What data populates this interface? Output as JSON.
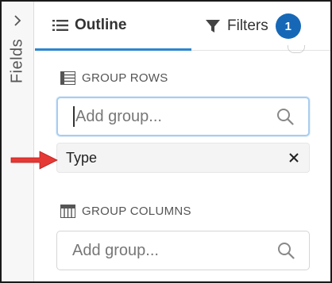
{
  "sidebar": {
    "label": "Fields",
    "toggle_icon": "chevron-right-icon"
  },
  "tabs": [
    {
      "label": "Outline",
      "icon": "list-icon",
      "active": true
    },
    {
      "label": "Filters",
      "icon": "filter-funnel-icon",
      "badge": "1"
    }
  ],
  "group_rows": {
    "header": "GROUP ROWS",
    "icon": "table-rows-icon",
    "search_placeholder": "Add group...",
    "items": [
      {
        "label": "Type",
        "remove_icon": "close-icon"
      }
    ]
  },
  "group_columns": {
    "header": "GROUP COLUMNS",
    "icon": "table-columns-icon",
    "search_placeholder": "Add group..."
  },
  "colors": {
    "accent": "#2b86cf",
    "badge": "#1668b7",
    "arrow": "#e53935"
  }
}
